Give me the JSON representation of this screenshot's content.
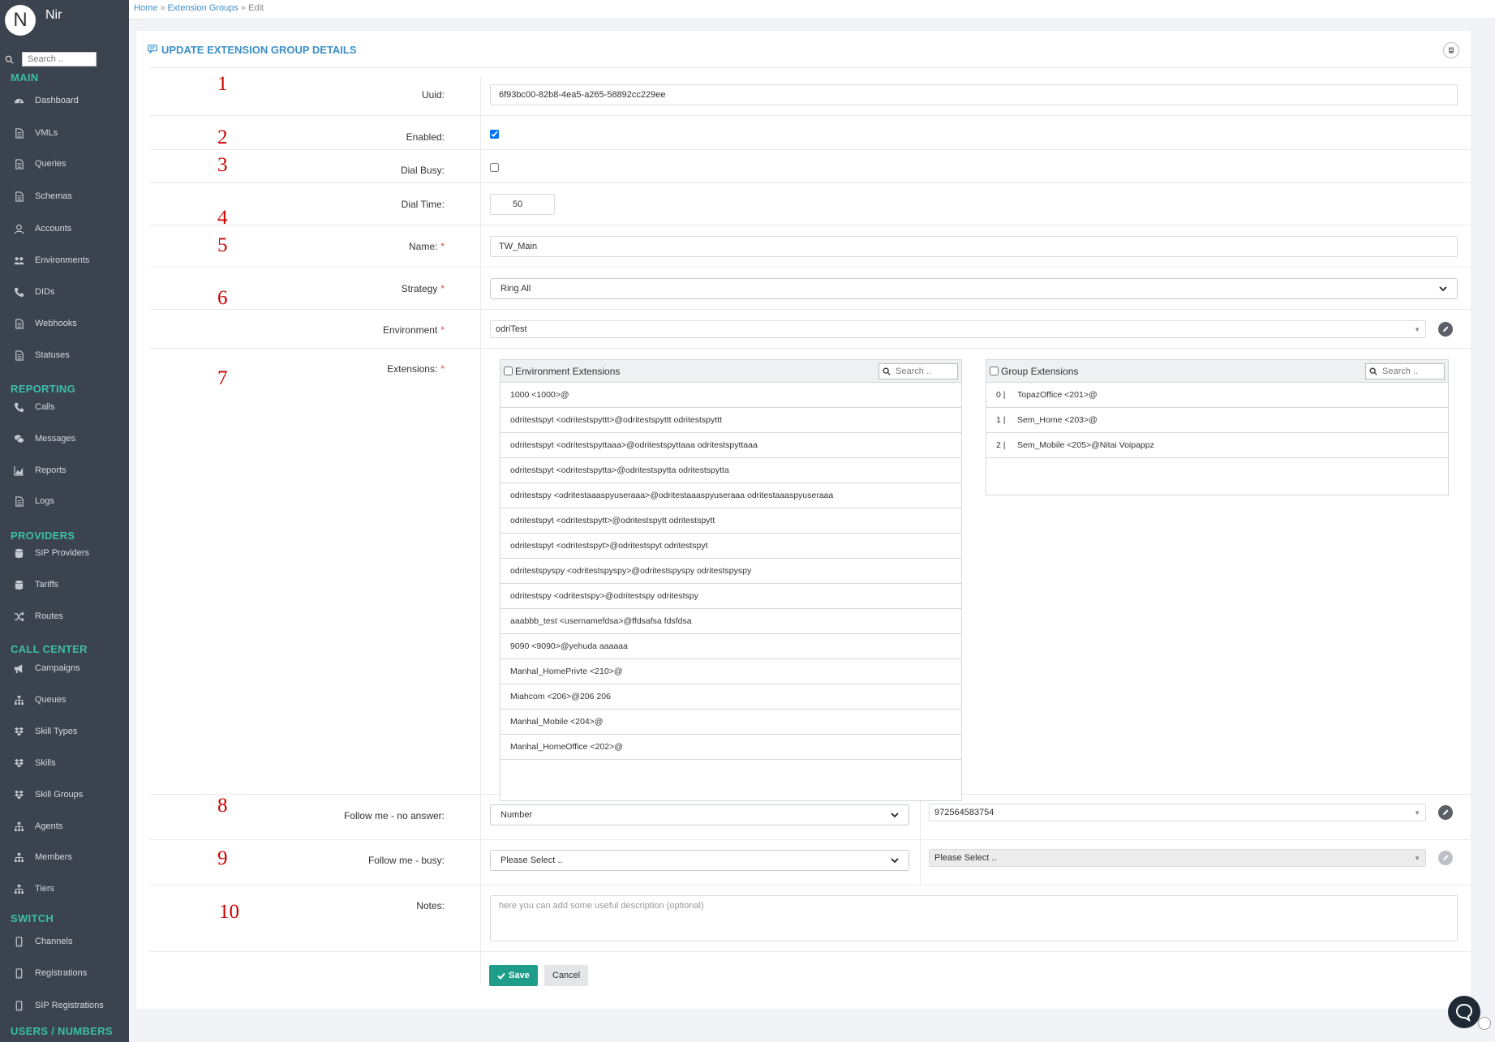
{
  "user": {
    "initial": "N",
    "name": "Nir"
  },
  "sidebar": {
    "search_placeholder": "Search ..",
    "sections": [
      {
        "title": "MAIN",
        "items": [
          {
            "label": "Dashboard",
            "icon": "dashboard-icon"
          },
          {
            "label": "VMLs",
            "icon": "document-icon"
          },
          {
            "label": "Queries",
            "icon": "document-icon"
          },
          {
            "label": "Schemas",
            "icon": "document-icon"
          },
          {
            "label": "Accounts",
            "icon": "user-icon"
          },
          {
            "label": "Environments",
            "icon": "users-icon"
          },
          {
            "label": "DIDs",
            "icon": "phone-icon"
          },
          {
            "label": "Webhooks",
            "icon": "document-icon"
          },
          {
            "label": "Statuses",
            "icon": "document-icon"
          }
        ]
      },
      {
        "title": "REPORTING",
        "items": [
          {
            "label": "Calls",
            "icon": "phone-icon"
          },
          {
            "label": "Messages",
            "icon": "chat-icon"
          },
          {
            "label": "Reports",
            "icon": "chart-icon"
          },
          {
            "label": "Logs",
            "icon": "document-icon"
          }
        ]
      },
      {
        "title": "PROVIDERS",
        "items": [
          {
            "label": "SIP Providers",
            "icon": "database-icon"
          },
          {
            "label": "Tariffs",
            "icon": "database-icon"
          },
          {
            "label": "Routes",
            "icon": "shuffle-icon"
          }
        ]
      },
      {
        "title": "CALL CENTER",
        "items": [
          {
            "label": "Campaigns",
            "icon": "megaphone-icon"
          },
          {
            "label": "Queues",
            "icon": "sitemap-icon"
          },
          {
            "label": "Skill Types",
            "icon": "dropbox-icon"
          },
          {
            "label": "Skills",
            "icon": "dropbox-icon"
          },
          {
            "label": "Skill Groups",
            "icon": "dropbox-icon"
          },
          {
            "label": "Agents",
            "icon": "sitemap-icon"
          },
          {
            "label": "Members",
            "icon": "sitemap-icon"
          },
          {
            "label": "Tiers",
            "icon": "sitemap-icon"
          }
        ]
      },
      {
        "title": "SWITCH",
        "items": [
          {
            "label": "Channels",
            "icon": "mobile-icon"
          },
          {
            "label": "Registrations",
            "icon": "mobile-icon"
          },
          {
            "label": "SIP Registrations",
            "icon": "mobile-icon"
          }
        ]
      },
      {
        "title": "USERS / NUMBERS",
        "items": []
      }
    ]
  },
  "breadcrumb": {
    "home": "Home",
    "sep": "»",
    "section": "Extension Groups",
    "current": "Edit"
  },
  "page_title": "UPDATE EXTENSION GROUP DETAILS",
  "annotations": [
    "1",
    "2",
    "3",
    "4",
    "5",
    "6",
    "7",
    "8",
    "9",
    "10"
  ],
  "form": {
    "uuid": {
      "label": "Uuid:",
      "value": "6f93bc00-82b8-4ea5-a265-58892cc229ee"
    },
    "enabled": {
      "label": "Enabled:",
      "checked": true
    },
    "dial_busy": {
      "label": "Dial Busy:",
      "checked": false
    },
    "dial_time": {
      "label": "Dial Time:",
      "value": "50"
    },
    "name": {
      "label": "Name:",
      "value": "TW_Main"
    },
    "strategy": {
      "label": "Strategy",
      "value": "Ring All"
    },
    "environment": {
      "label": "Environment",
      "value": "odriTest"
    },
    "extensions": {
      "label": "Extensions:",
      "available_title": "Environment Extensions",
      "selected_title": "Group Extensions",
      "search_placeholder": "Search ..",
      "available": [
        "1000 <1000>@",
        "odritestspyt <odritestspyttt>@odritestspyttt odritestspyttt",
        "odritestspyt <odritestspyttaaa>@odritestspyttaaa odritestspyttaaa",
        "odritestspyt <odritestspytta>@odritestspytta odritestspytta",
        "odritestspy <odritestaaaspyuseraaa>@odritestaaaspyuseraaa odritestaaaspyuseraaa",
        "odritestspyt <odritestspytt>@odritestspytt odritestspytt",
        "odritestspyt <odritestspyt>@odritestspyt odritestspyt",
        "odritestspyspy <odritestspyspy>@odritestspyspy odritestspyspy",
        "odritestspy <odritestspy>@odritestspy odritestspy",
        "aaabbb_test <usernamefdsa>@ffdsafsa fdsfdsa",
        "9090 <9090>@yehuda aaaaaa",
        "Manhal_HomePrivte <210>@",
        "Miahcom <206>@206 206",
        "Manhal_Mobile <204>@",
        "Manhal_HomeOffice <202>@"
      ],
      "selected": [
        {
          "index": "0 |",
          "label": "TopazOffice <201>@"
        },
        {
          "index": "1 |",
          "label": "Sem_Home <203>@"
        },
        {
          "index": "2 |",
          "label": "Sem_Mobile <205>@Nitai Voipappz"
        }
      ]
    },
    "follow_no_answer": {
      "label": "Follow me - no answer:",
      "type": "Number",
      "value": "972564583754"
    },
    "follow_busy": {
      "label": "Follow me - busy:",
      "type": "Please Select ..",
      "value": "Please Select .."
    },
    "notes": {
      "label": "Notes:",
      "placeholder": "here you can add some useful description (optional)"
    }
  },
  "buttons": {
    "save": "Save",
    "cancel": "Cancel"
  },
  "colors": {
    "sidebar_bg": "#3b434e",
    "section": "#3dbfa9",
    "accent": "#3b8fc8",
    "save": "#1e9e8a",
    "required": "#d9534f",
    "annotation": "#cc0000"
  }
}
